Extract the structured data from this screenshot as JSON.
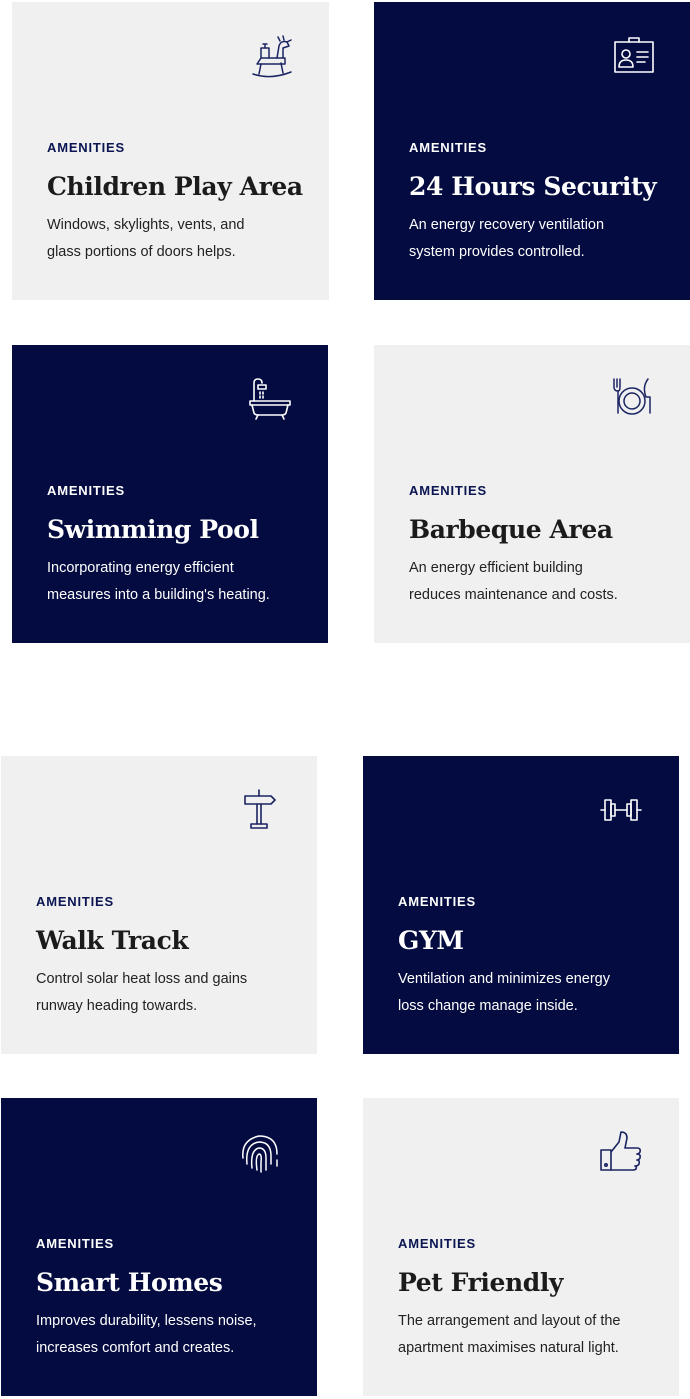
{
  "colors": {
    "navy": "#040b40",
    "light_gray": "#f0f0f0"
  },
  "cards": [
    {
      "eyebrow": "AMENITIES",
      "title": "Children Play Area",
      "desc_line1": "Windows, skylights, vents, and",
      "desc_line2": "glass portions of doors helps.",
      "icon": "rocking-horse-icon",
      "theme": "light"
    },
    {
      "eyebrow": "AMENITIES",
      "title": "24 Hours Security",
      "desc_line1": "An energy recovery ventilation",
      "desc_line2": "system provides controlled.",
      "icon": "id-card-icon",
      "theme": "dark"
    },
    {
      "eyebrow": "AMENITIES",
      "title": "Swimming Pool",
      "desc_line1": "Incorporating energy efficient",
      "desc_line2": "measures into a building's heating.",
      "icon": "bathtub-icon",
      "theme": "dark"
    },
    {
      "eyebrow": "AMENITIES",
      "title": "Barbeque Area",
      "desc_line1": "An energy efficient building",
      "desc_line2": "reduces maintenance and costs.",
      "icon": "plate-cutlery-icon",
      "theme": "light"
    },
    {
      "eyebrow": "AMENITIES",
      "title": "Walk Track",
      "desc_line1": "Control solar heat loss and gains",
      "desc_line2": "runway heading towards.",
      "icon": "signpost-icon",
      "theme": "light"
    },
    {
      "eyebrow": "AMENITIES",
      "title": "GYM",
      "desc_line1": "Ventilation and minimizes energy",
      "desc_line2": "loss change manage inside.",
      "icon": "dumbbell-icon",
      "theme": "dark"
    },
    {
      "eyebrow": "AMENITIES",
      "title": "Smart Homes",
      "desc_line1": "Improves durability, lessens noise,",
      "desc_line2": "increases comfort and creates.",
      "icon": "fingerprint-icon",
      "theme": "dark"
    },
    {
      "eyebrow": "AMENITIES",
      "title": "Pet Friendly",
      "desc_line1": "The arrangement and layout of the",
      "desc_line2": "apartment maximises natural light.",
      "icon": "thumbs-up-icon",
      "theme": "light"
    }
  ]
}
